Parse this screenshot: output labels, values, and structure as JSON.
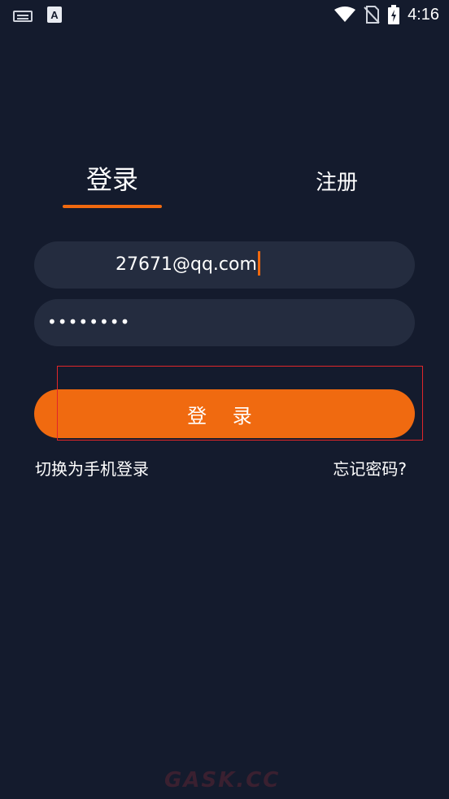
{
  "status_bar": {
    "time": "4:16",
    "icons": [
      "keyboard-icon",
      "a-text-icon",
      "wifi-icon",
      "no-sim-icon",
      "battery-charging-icon"
    ]
  },
  "tabs": {
    "login": "登录",
    "register": "注册",
    "active": "login"
  },
  "form": {
    "email_value": "27671@qq.com",
    "password_value": "••••••••"
  },
  "login_button": "登 录",
  "links": {
    "switch_phone": "切换为手机登录",
    "forgot_password": "忘记密码?"
  },
  "watermark": "GASK.CC",
  "colors": {
    "background": "#141b2d",
    "field_bg": "#242c3f",
    "accent": "#f06a10",
    "highlight": "#e0262a"
  }
}
